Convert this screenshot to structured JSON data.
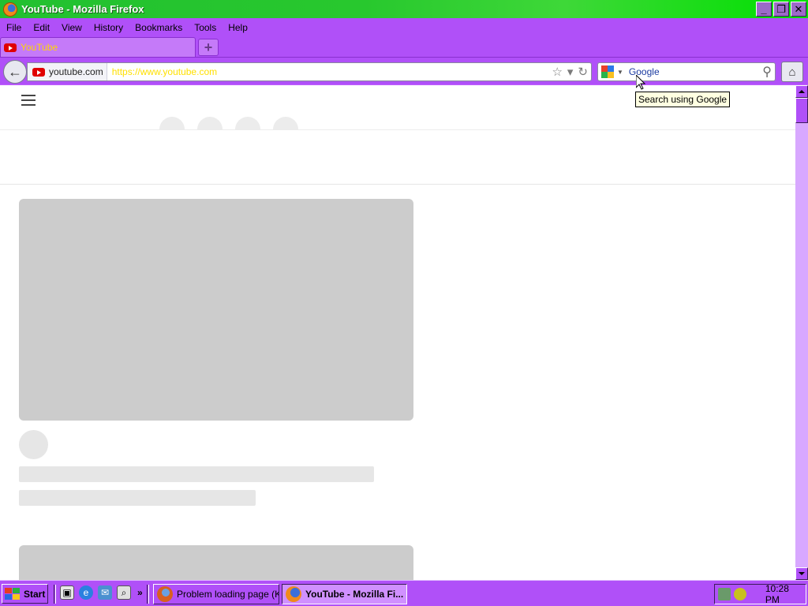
{
  "window": {
    "title": "YouTube - Mozilla Firefox",
    "controls": {
      "minimize": "_",
      "restore": "❐",
      "close": "✕"
    }
  },
  "menubar": {
    "items": [
      {
        "label": "File"
      },
      {
        "label": "Edit"
      },
      {
        "label": "View"
      },
      {
        "label": "History"
      },
      {
        "label": "Bookmarks"
      },
      {
        "label": "Tools"
      },
      {
        "label": "Help"
      }
    ]
  },
  "tabs": {
    "active": {
      "label": "YouTube",
      "icon": "youtube-icon"
    },
    "new_tab_label": "+"
  },
  "navbar": {
    "back_icon": "←",
    "identity_domain": "youtube.com",
    "url": "https://www.youtube.com",
    "bookmark_star": "☆",
    "dropdown_arrow": "▾",
    "reload_icon": "↻",
    "search_placeholder": "Google",
    "search_icon": "⚲",
    "home_icon": "⌂"
  },
  "tooltip": {
    "text": "Search using Google"
  },
  "scrollbar": {
    "position": 0.0
  },
  "taskbar": {
    "start_label": "Start",
    "quick_launch_more": "»",
    "tasks": [
      {
        "label": "Problem loading page (K...",
        "active": false
      },
      {
        "label": "YouTube - Mozilla Fi...",
        "active": true
      }
    ],
    "clock": "10:28 PM"
  },
  "colors": {
    "titlebar": "#22c030",
    "chrome": "#b050f8",
    "tab_text": "#ffd800",
    "placeholder_gray": "#cccccc"
  }
}
